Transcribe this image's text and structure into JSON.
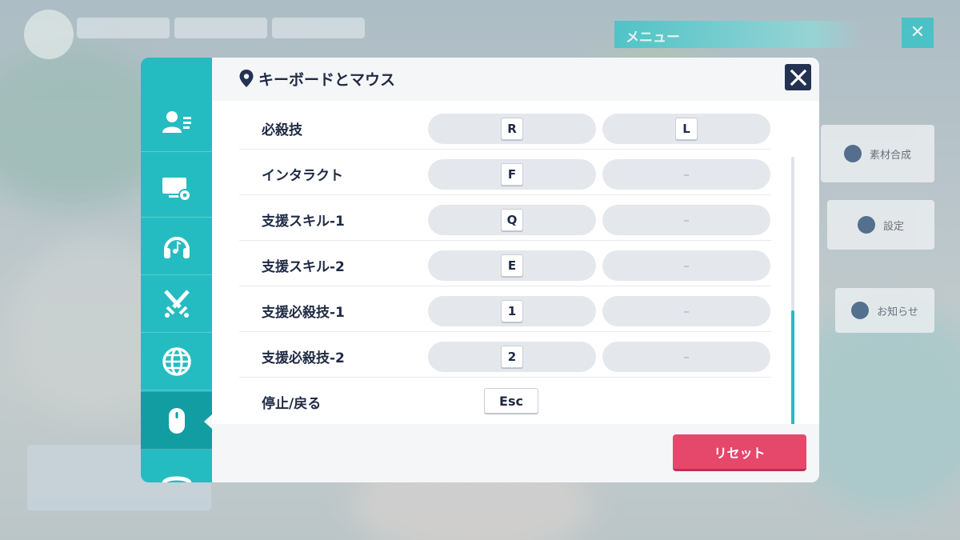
{
  "background": {
    "menu_title": "メニュー",
    "menu_close": "✕",
    "button_1": "素材合成",
    "button_2": "設定",
    "button_3": "お知らせ"
  },
  "sidebar": {
    "tabs": [
      {
        "icon": "profile-list-icon",
        "active": false
      },
      {
        "icon": "display-settings-icon",
        "active": false
      },
      {
        "icon": "headphones-icon",
        "active": false
      },
      {
        "icon": "crossed-swords-icon",
        "active": false
      },
      {
        "icon": "globe-icon",
        "active": false
      },
      {
        "icon": "mouse-icon",
        "active": true
      },
      {
        "icon": "gamepad-icon",
        "active": false
      }
    ]
  },
  "panel": {
    "title": "キーボードとマウス",
    "close_label": "✕"
  },
  "bindings": [
    {
      "action": "必殺技",
      "primary": "R",
      "secondary": "L"
    },
    {
      "action": "インタラクト",
      "primary": "F",
      "secondary": "–"
    },
    {
      "action": "支援スキル-1",
      "primary": "Q",
      "secondary": "–"
    },
    {
      "action": "支援スキル-2",
      "primary": "E",
      "secondary": "–"
    },
    {
      "action": "支援必殺技-1",
      "primary": "1",
      "secondary": "–"
    },
    {
      "action": "支援必殺技-2",
      "primary": "2",
      "secondary": "–"
    },
    {
      "action": "停止/戻る",
      "primary": "Esc"
    }
  ],
  "footer": {
    "reset_label": "リセット"
  },
  "colors": {
    "accent": "#25bcc1",
    "accent_dark": "#129da3",
    "reset": "#e5486b",
    "text": "#1f2a44"
  }
}
